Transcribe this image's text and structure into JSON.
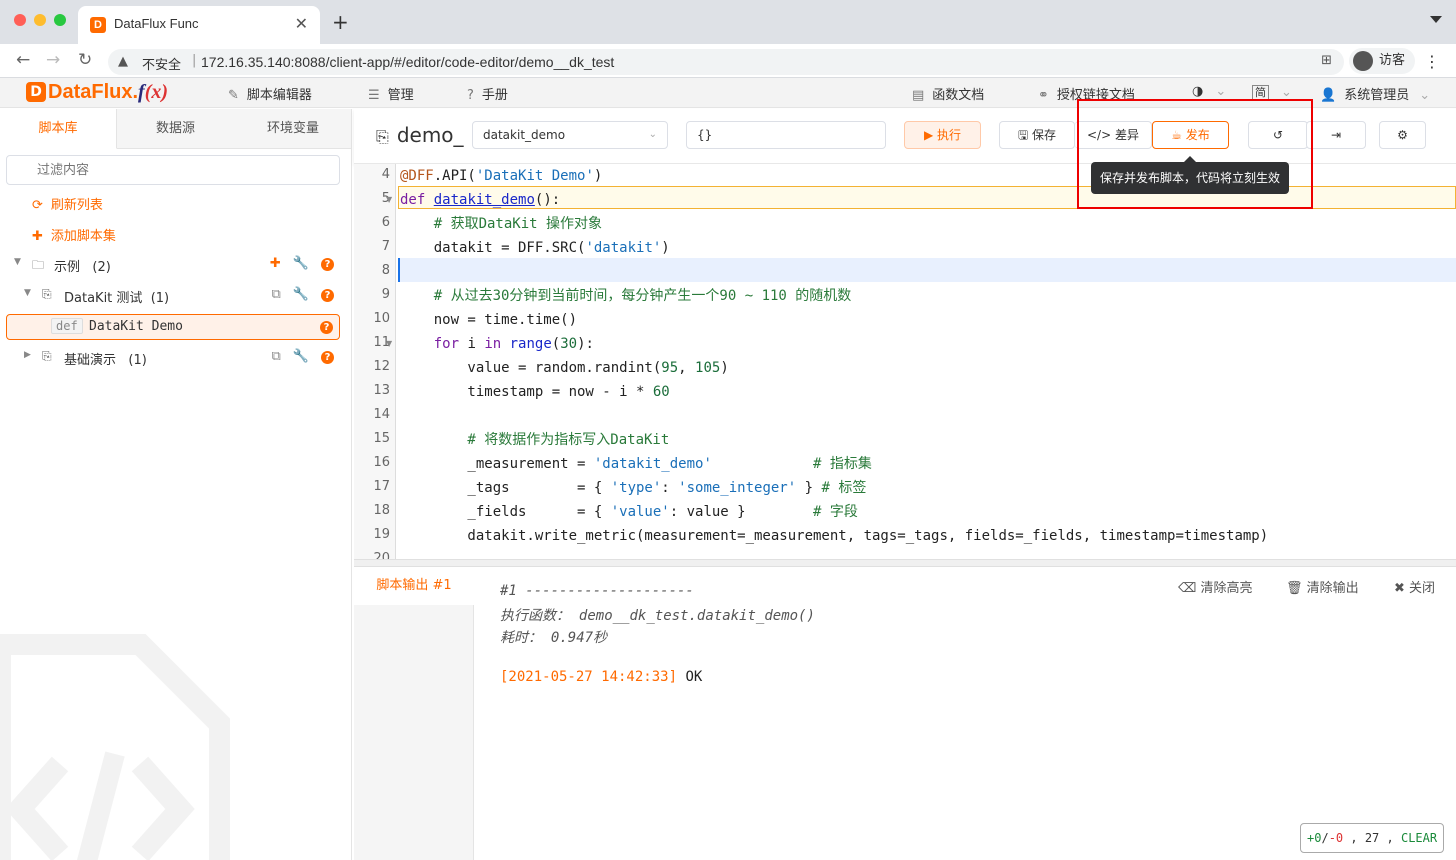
{
  "browser": {
    "tab_title": "DataFlux Func",
    "not_secure": "不安全",
    "url": "172.16.35.140:8088/client-app/#/editor/code-editor/demo__dk_test",
    "profile": "访客"
  },
  "header": {
    "logo_text": "DataFlux.",
    "logo_f": "f",
    "logo_x": "(x)",
    "nav": [
      "脚本编辑器",
      "管理",
      "手册"
    ],
    "func_docs": "函数文档",
    "auth_docs": "授权链接文档",
    "lang": "简",
    "user": "系统管理员"
  },
  "sidebar": {
    "tabs": [
      "脚本库",
      "数据源",
      "环境变量"
    ],
    "filter_placeholder": "过滤内容",
    "refresh": "刷新列表",
    "add_set": "添加脚本集",
    "tree": [
      {
        "label": "示例",
        "count": "(2)"
      },
      {
        "label": "DataKit 测试",
        "count": "(1)"
      },
      {
        "badge": "def",
        "label": "DataKit Demo"
      },
      {
        "label": "基础演示",
        "count": "(1)"
      }
    ]
  },
  "editor": {
    "script_name": "demo_",
    "func_select": "datakit_demo",
    "args_input": "{}",
    "buttons": {
      "run": "执行",
      "save": "保存",
      "diff": "差异",
      "publish": "发布"
    },
    "tooltip": "保存并发布脚本，代码将立刻生效",
    "line_numbers": [
      "4",
      "5",
      "6",
      "7",
      "8",
      "9",
      "10",
      "11",
      "12",
      "13",
      "14",
      "15",
      "16",
      "17",
      "18",
      "19",
      "20"
    ]
  },
  "output": {
    "tab": "脚本输出 #1",
    "clear_highlight": "清除高亮",
    "clear_output": "清除输出",
    "close": "关闭",
    "header": "#1 --------------------",
    "exec_label": "执行函数：",
    "exec_func": "demo__dk_test.datakit_demo()",
    "time_label": "耗时：",
    "time_value": "0.947秒",
    "timestamp": "[2021-05-27 14:42:33]",
    "result": "OK"
  },
  "status": {
    "added": "+0",
    "removed": "-0",
    "line": "27",
    "state": "CLEAR"
  },
  "colors": {
    "accent": "#ff6a00",
    "highlight_box": "#ee0000"
  }
}
